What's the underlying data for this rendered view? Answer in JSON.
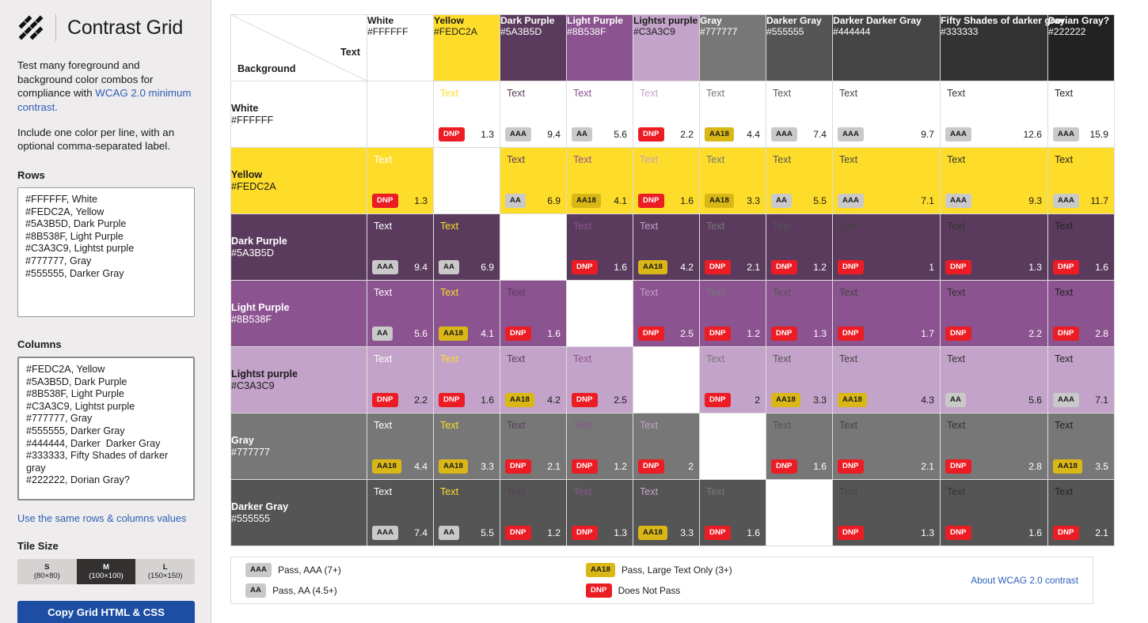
{
  "sidebar": {
    "brand_title": "Contrast Grid",
    "intro_part1": "Test many foreground and background color combos for compliance with ",
    "intro_link": "WCAG 2.0 minimum contrast.",
    "intro_part2": "Include one color per line, with an optional comma-separated label.",
    "rows_label": "Rows",
    "rows_value": "#FFFFFF, White\n#FEDC2A, Yellow\n#5A3B5D, Dark Purple\n#8B538F, Light Purple\n#C3A3C9, Lightst purple\n#777777, Gray\n#555555, Darker Gray",
    "columns_label": "Columns",
    "columns_value": "#FEDC2A, Yellow\n#5A3B5D, Dark Purple\n#8B538F, Light Purple\n#C3A3C9, Lightst purple\n#777777, Gray\n#555555, Darker Gray\n#444444, Darker  Darker Gray\n#333333, Fifty Shades of darker gray\n#222222, Dorian Gray?",
    "same_values_link": "Use the same rows & columns values",
    "tile_size_label": "Tile Size",
    "tile_sizes": [
      {
        "name": "S",
        "dims": "(80×80)",
        "active": false
      },
      {
        "name": "M",
        "dims": "(100×100)",
        "active": true
      },
      {
        "name": "L",
        "dims": "(150×150)",
        "active": false
      }
    ],
    "copy_button": "Copy Grid HTML & CSS"
  },
  "grid": {
    "corner_text_label": "Text",
    "corner_bg_label": "Background",
    "sample_word": "Text",
    "columns": [
      {
        "name": "White",
        "hex": "#FFFFFF",
        "bg": "#FFFFFF",
        "fg": "#1b1b1b",
        "wide": false
      },
      {
        "name": "Yellow",
        "hex": "#FEDC2A",
        "bg": "#FEDC2A",
        "fg": "#1b1b1b",
        "wide": false
      },
      {
        "name": "Dark Purple",
        "hex": "#5A3B5D",
        "bg": "#5A3B5D",
        "fg": "#FFFFFF",
        "wide": false
      },
      {
        "name": "Light Purple",
        "hex": "#8B538F",
        "bg": "#8B538F",
        "fg": "#FFFFFF",
        "wide": false
      },
      {
        "name": "Lightst purple",
        "hex": "#C3A3C9",
        "bg": "#C3A3C9",
        "fg": "#1b1b1b",
        "wide": false
      },
      {
        "name": "Gray",
        "hex": "#777777",
        "bg": "#777777",
        "fg": "#FFFFFF",
        "wide": false
      },
      {
        "name": "Darker Gray",
        "hex": "#555555",
        "bg": "#555555",
        "fg": "#FFFFFF",
        "wide": false
      },
      {
        "name": "Darker Darker Gray",
        "hex": "#444444",
        "bg": "#444444",
        "fg": "#FFFFFF",
        "wide": true
      },
      {
        "name": "Fifty Shades of darker gray",
        "hex": "#333333",
        "bg": "#333333",
        "fg": "#FFFFFF",
        "wide": true
      },
      {
        "name": "Dorian Gray?",
        "hex": "#222222",
        "bg": "#222222",
        "fg": "#FFFFFF",
        "wide": false
      }
    ],
    "rows": [
      {
        "name": "White",
        "hex": "#FFFFFF",
        "bg": "#FFFFFF",
        "fg": "#1b1b1b",
        "cells": [
          {
            "blank": true
          },
          {
            "badge": "DNP",
            "ratio": "1.3"
          },
          {
            "badge": "AAA",
            "ratio": "9.4"
          },
          {
            "badge": "AA",
            "ratio": "5.6"
          },
          {
            "badge": "DNP",
            "ratio": "2.2"
          },
          {
            "badge": "AA18",
            "ratio": "4.4"
          },
          {
            "badge": "AAA",
            "ratio": "7.4"
          },
          {
            "badge": "AAA",
            "ratio": "9.7"
          },
          {
            "badge": "AAA",
            "ratio": "12.6"
          },
          {
            "badge": "AAA",
            "ratio": "15.9"
          }
        ]
      },
      {
        "name": "Yellow",
        "hex": "#FEDC2A",
        "bg": "#FEDC2A",
        "fg": "#1b1b1b",
        "cells": [
          {
            "badge": "DNP",
            "ratio": "1.3"
          },
          {
            "blank": true
          },
          {
            "badge": "AA",
            "ratio": "6.9"
          },
          {
            "badge": "AA18",
            "ratio": "4.1"
          },
          {
            "badge": "DNP",
            "ratio": "1.6"
          },
          {
            "badge": "AA18",
            "ratio": "3.3"
          },
          {
            "badge": "AA",
            "ratio": "5.5"
          },
          {
            "badge": "AAA",
            "ratio": "7.1"
          },
          {
            "badge": "AAA",
            "ratio": "9.3"
          },
          {
            "badge": "AAA",
            "ratio": "11.7"
          }
        ]
      },
      {
        "name": "Dark Purple",
        "hex": "#5A3B5D",
        "bg": "#5A3B5D",
        "fg": "#FFFFFF",
        "cells": [
          {
            "badge": "AAA",
            "ratio": "9.4"
          },
          {
            "badge": "AA",
            "ratio": "6.9"
          },
          {
            "blank": true
          },
          {
            "badge": "DNP",
            "ratio": "1.6"
          },
          {
            "badge": "AA18",
            "ratio": "4.2"
          },
          {
            "badge": "DNP",
            "ratio": "2.1"
          },
          {
            "badge": "DNP",
            "ratio": "1.2"
          },
          {
            "badge": "DNP",
            "ratio": "1"
          },
          {
            "badge": "DNP",
            "ratio": "1.3"
          },
          {
            "badge": "DNP",
            "ratio": "1.6"
          }
        ]
      },
      {
        "name": "Light Purple",
        "hex": "#8B538F",
        "bg": "#8B538F",
        "fg": "#FFFFFF",
        "cells": [
          {
            "badge": "AA",
            "ratio": "5.6"
          },
          {
            "badge": "AA18",
            "ratio": "4.1"
          },
          {
            "badge": "DNP",
            "ratio": "1.6"
          },
          {
            "blank": true
          },
          {
            "badge": "DNP",
            "ratio": "2.5"
          },
          {
            "badge": "DNP",
            "ratio": "1.2"
          },
          {
            "badge": "DNP",
            "ratio": "1.3"
          },
          {
            "badge": "DNP",
            "ratio": "1.7"
          },
          {
            "badge": "DNP",
            "ratio": "2.2"
          },
          {
            "badge": "DNP",
            "ratio": "2.8"
          }
        ]
      },
      {
        "name": "Lightst purple",
        "hex": "#C3A3C9",
        "bg": "#C3A3C9",
        "fg": "#1b1b1b",
        "cells": [
          {
            "badge": "DNP",
            "ratio": "2.2"
          },
          {
            "badge": "DNP",
            "ratio": "1.6"
          },
          {
            "badge": "AA18",
            "ratio": "4.2"
          },
          {
            "badge": "DNP",
            "ratio": "2.5"
          },
          {
            "blank": true
          },
          {
            "badge": "DNP",
            "ratio": "2"
          },
          {
            "badge": "AA18",
            "ratio": "3.3"
          },
          {
            "badge": "AA18",
            "ratio": "4.3"
          },
          {
            "badge": "AA",
            "ratio": "5.6"
          },
          {
            "badge": "AAA",
            "ratio": "7.1"
          }
        ]
      },
      {
        "name": "Gray",
        "hex": "#777777",
        "bg": "#777777",
        "fg": "#FFFFFF",
        "cells": [
          {
            "badge": "AA18",
            "ratio": "4.4"
          },
          {
            "badge": "AA18",
            "ratio": "3.3"
          },
          {
            "badge": "DNP",
            "ratio": "2.1"
          },
          {
            "badge": "DNP",
            "ratio": "1.2"
          },
          {
            "badge": "DNP",
            "ratio": "2"
          },
          {
            "blank": true
          },
          {
            "badge": "DNP",
            "ratio": "1.6"
          },
          {
            "badge": "DNP",
            "ratio": "2.1"
          },
          {
            "badge": "DNP",
            "ratio": "2.8"
          },
          {
            "badge": "AA18",
            "ratio": "3.5"
          }
        ]
      },
      {
        "name": "Darker Gray",
        "hex": "#555555",
        "bg": "#555555",
        "fg": "#FFFFFF",
        "cells": [
          {
            "badge": "AAA",
            "ratio": "7.4"
          },
          {
            "badge": "AA",
            "ratio": "5.5"
          },
          {
            "badge": "DNP",
            "ratio": "1.2"
          },
          {
            "badge": "DNP",
            "ratio": "1.3"
          },
          {
            "badge": "AA18",
            "ratio": "3.3"
          },
          {
            "badge": "DNP",
            "ratio": "1.6"
          },
          {
            "blank": true
          },
          {
            "badge": "DNP",
            "ratio": "1.3"
          },
          {
            "badge": "DNP",
            "ratio": "1.6"
          },
          {
            "badge": "DNP",
            "ratio": "2.1"
          }
        ]
      }
    ]
  },
  "legend": {
    "items": [
      {
        "badge": "AAA",
        "text": "Pass, AAA (7+)"
      },
      {
        "badge": "AA",
        "text": "Pass, AA (4.5+)"
      },
      {
        "badge": "AA18",
        "text": "Pass, Large Text Only (3+)"
      },
      {
        "badge": "DNP",
        "text": "Does Not Pass"
      }
    ],
    "about_link": "About WCAG 2.0 contrast"
  }
}
